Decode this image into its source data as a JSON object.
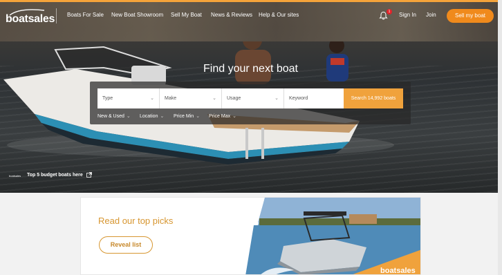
{
  "nav": {
    "logo_text": "boatsales",
    "links": [
      "Boats For Sale",
      "New Boat Showroom",
      "Sell My Boat",
      "News & Reviews",
      "Help & Our sites"
    ],
    "notification_count": "1",
    "sign_in": "Sign In",
    "join": "Join",
    "sell_button": "Sell my boat"
  },
  "hero": {
    "title": "Find your next boat",
    "search": {
      "type_placeholder": "Type",
      "make_placeholder": "Make",
      "usage_placeholder": "Usage",
      "keyword_placeholder": "Keyword",
      "search_button": "Search 14,992 boats"
    },
    "filters": [
      "New & Used",
      "Location",
      "Price Min",
      "Price Max"
    ],
    "budget_link": "Top 5 budget boats here",
    "budget_logo_text": "boatsales"
  },
  "promo": {
    "title": "Read our top picks",
    "button": "Reveal list",
    "photo_logo_text": "boatsales"
  },
  "colors": {
    "accent": "#f08a1c",
    "search_button": "#f0a23c",
    "promo_gold": "#d79630",
    "badge": "#e2232a"
  },
  "icons": [
    "bell-icon",
    "chevron-down-icon",
    "external-link-icon"
  ]
}
